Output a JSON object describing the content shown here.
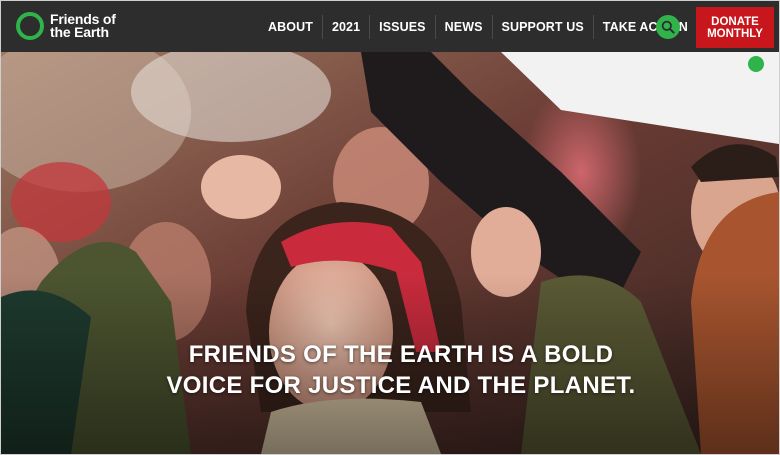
{
  "logo": {
    "line1": "Friends of",
    "line2": "the Earth",
    "icon": "ring-logo-icon"
  },
  "nav": {
    "items": [
      {
        "label": "ABOUT"
      },
      {
        "label": "2021"
      },
      {
        "label": "ISSUES"
      },
      {
        "label": "NEWS"
      },
      {
        "label": "SUPPORT US"
      },
      {
        "label": "TAKE ACTION"
      }
    ],
    "search_icon": "search-icon"
  },
  "donate": {
    "line1": "DONATE",
    "line2": "MONTHLY"
  },
  "hero": {
    "caption_line1": "FRIENDS OF THE EARTH IS A BOLD",
    "caption_line2": "VOICE FOR JUSTICE AND THE PLANET.",
    "image": "protest-crowd-photo",
    "banner_text": "Friends of the Earth"
  },
  "colors": {
    "header_bg": "#2d2d2d",
    "brand_green": "#2fb34a",
    "donate_red": "#c8161d"
  }
}
